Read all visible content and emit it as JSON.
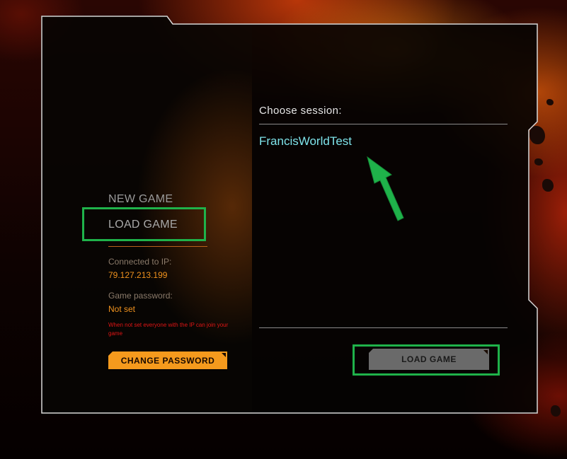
{
  "menu": {
    "new_game": "NEW GAME",
    "load_game": "LOAD GAME"
  },
  "info": {
    "connected_label": "Connected to IP:",
    "ip": "79.127.213.199",
    "password_label": "Game password:",
    "password_value": "Not set",
    "warning": "When not set everyone with the IP can join your game"
  },
  "buttons": {
    "change_password": "CHANGE PASSWORD",
    "load_game": "LOAD GAME"
  },
  "sessions": {
    "heading": "Choose session:",
    "items": [
      "FrancisWorldTest"
    ]
  },
  "colors": {
    "accent_orange": "#f59a1d",
    "session_cyan": "#7ee3ea",
    "warning_red": "#e01515",
    "annotation_green": "#1fb24a"
  }
}
